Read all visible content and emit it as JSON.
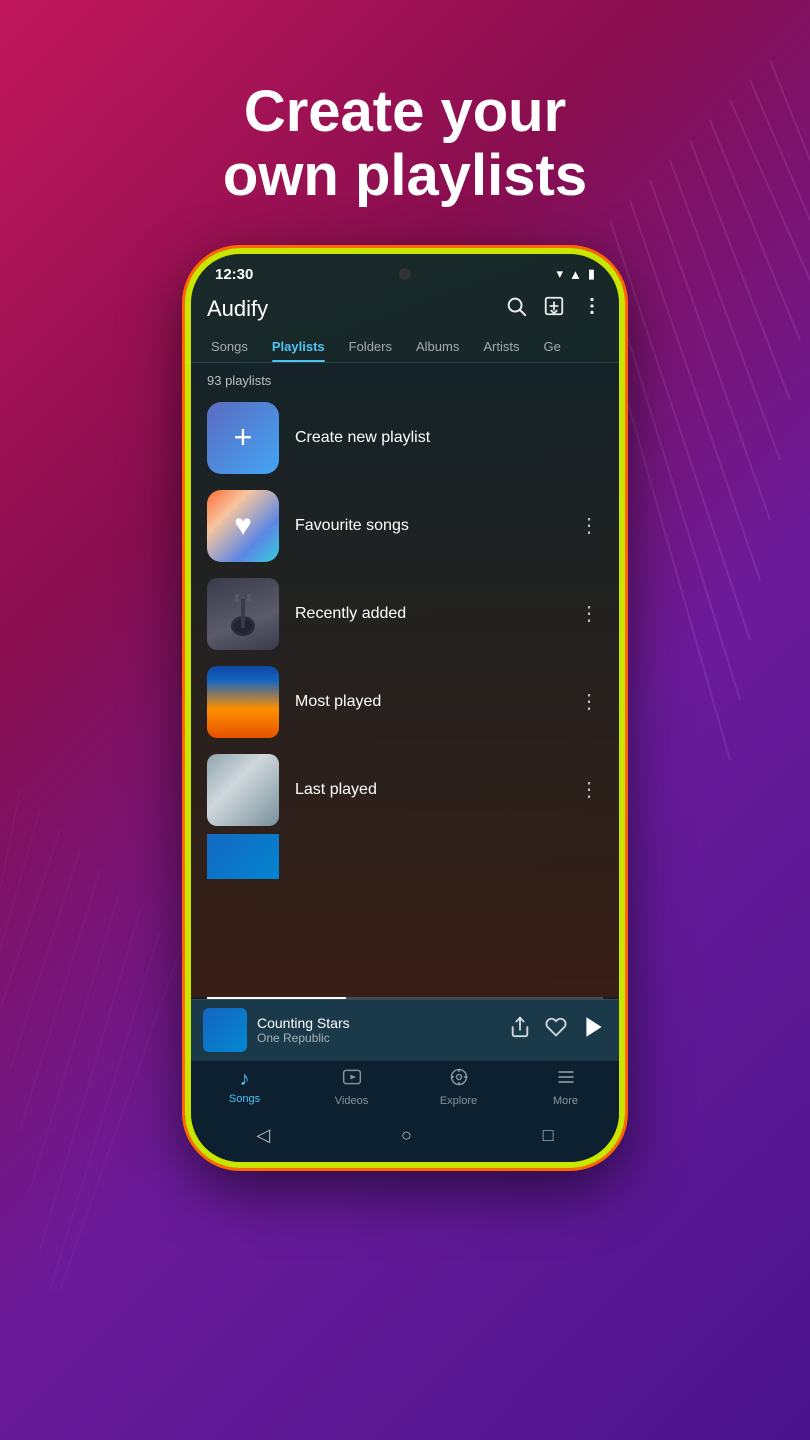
{
  "background": {
    "gradient_start": "#c2185b",
    "gradient_end": "#4a148c"
  },
  "headline": {
    "line1": "Create your",
    "line2": "own playlists"
  },
  "phone": {
    "status_bar": {
      "time": "12:30",
      "wifi_icon": "▾",
      "signal_icon": "▲",
      "battery_icon": "▮"
    },
    "app_bar": {
      "title": "Audify",
      "search_icon": "search",
      "import_icon": "import",
      "more_icon": "more"
    },
    "tabs": [
      {
        "label": "Songs",
        "active": false
      },
      {
        "label": "Playlists",
        "active": true
      },
      {
        "label": "Folders",
        "active": false
      },
      {
        "label": "Albums",
        "active": false
      },
      {
        "label": "Artists",
        "active": false
      },
      {
        "label": "Ge",
        "active": false
      }
    ],
    "playlist_count": "93 playlists",
    "playlists": [
      {
        "id": "create",
        "name": "Create new playlist",
        "thumb_type": "create",
        "show_more": false
      },
      {
        "id": "favourite",
        "name": "Favourite songs",
        "thumb_type": "favourite",
        "show_more": true
      },
      {
        "id": "recently-added",
        "name": "Recently added",
        "thumb_type": "guitar",
        "show_more": true
      },
      {
        "id": "most-played",
        "name": "Most played",
        "thumb_type": "concert",
        "show_more": true
      },
      {
        "id": "last-played",
        "name": "Last played",
        "thumb_type": "last",
        "show_more": true
      },
      {
        "id": "partial",
        "name": "",
        "thumb_type": "partial",
        "show_more": false
      }
    ],
    "now_playing": {
      "title": "Counting Stars",
      "artist": "One Republic",
      "progress": 35
    },
    "bottom_nav": [
      {
        "label": "Songs",
        "icon": "♪",
        "active": true
      },
      {
        "label": "Videos",
        "icon": "▣",
        "active": false
      },
      {
        "label": "Explore",
        "icon": "⚛",
        "active": false
      },
      {
        "label": "More",
        "icon": "≡",
        "active": false
      }
    ],
    "android_nav": {
      "back": "◁",
      "home": "○",
      "recents": "□"
    }
  }
}
